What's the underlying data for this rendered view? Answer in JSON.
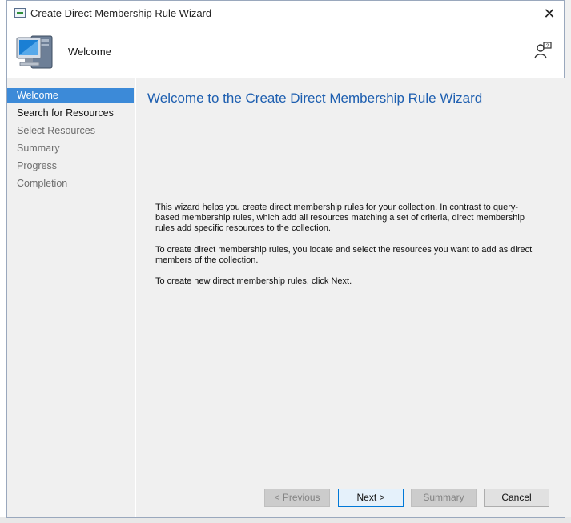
{
  "window": {
    "title": "Create Direct Membership Rule Wizard",
    "close_glyph": "✕"
  },
  "header": {
    "title": "Welcome"
  },
  "steps": [
    {
      "label": "Welcome",
      "state": "active"
    },
    {
      "label": "Search for Resources",
      "state": "next"
    },
    {
      "label": "Select Resources",
      "state": "pending"
    },
    {
      "label": "Summary",
      "state": "pending"
    },
    {
      "label": "Progress",
      "state": "pending"
    },
    {
      "label": "Completion",
      "state": "pending"
    }
  ],
  "content": {
    "title": "Welcome to the Create Direct Membership Rule Wizard",
    "paragraph1": "This wizard helps you create direct membership rules for your collection. In contrast to query-based membership rules, which add all resources matching a set of criteria, direct membership rules add specific resources to the collection.",
    "paragraph2": "To create direct membership rules, you locate and select the resources you want to add as direct members of the collection.",
    "paragraph3": "To create new direct membership rules, click Next."
  },
  "buttons": {
    "previous": "< Previous",
    "next": "Next >",
    "summary": "Summary",
    "cancel": "Cancel"
  },
  "colors": {
    "accent": "#3c8ad8",
    "title_blue": "#1e5fb0"
  }
}
